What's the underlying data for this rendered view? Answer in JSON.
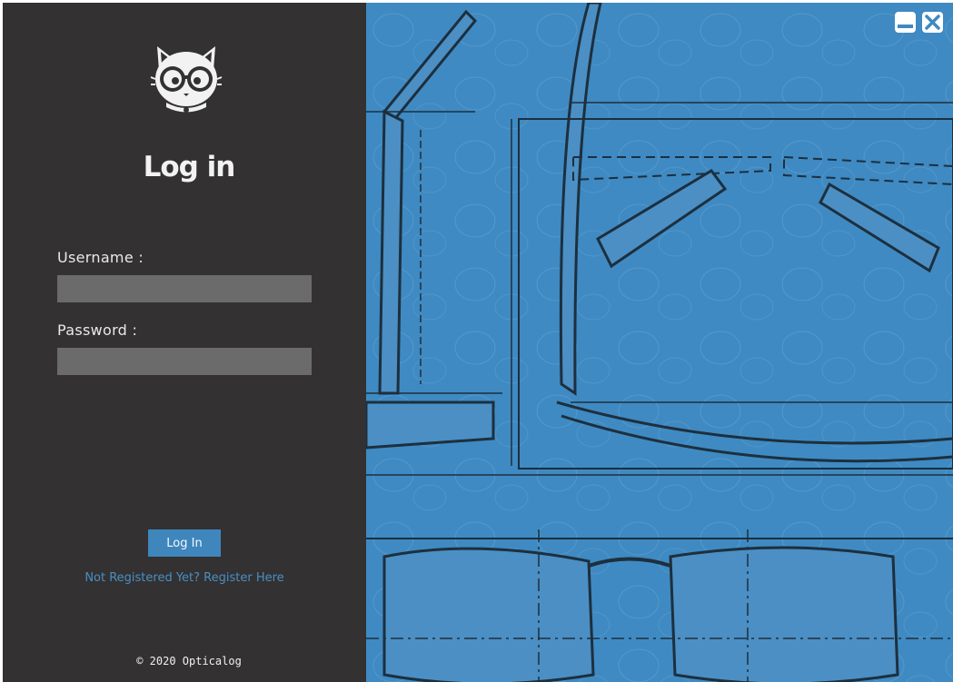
{
  "app": {
    "title": "Log in",
    "footer": "© 2020 Opticalog"
  },
  "icons": {
    "logo": "cat-with-glasses-logo",
    "minimize": "minimize-icon",
    "close": "close-icon"
  },
  "form": {
    "username_label": "Username :",
    "username_value": "",
    "password_label": "Password :",
    "password_value": "",
    "submit_label": "Log In",
    "register_link": "Not Registered Yet? Register Here"
  },
  "colors": {
    "panel_bg": "#333132",
    "input_bg": "#6b6b6b",
    "accent": "#3f86bd",
    "link": "#4a8fc4",
    "blueprint_bg": "#3f8ac2"
  }
}
